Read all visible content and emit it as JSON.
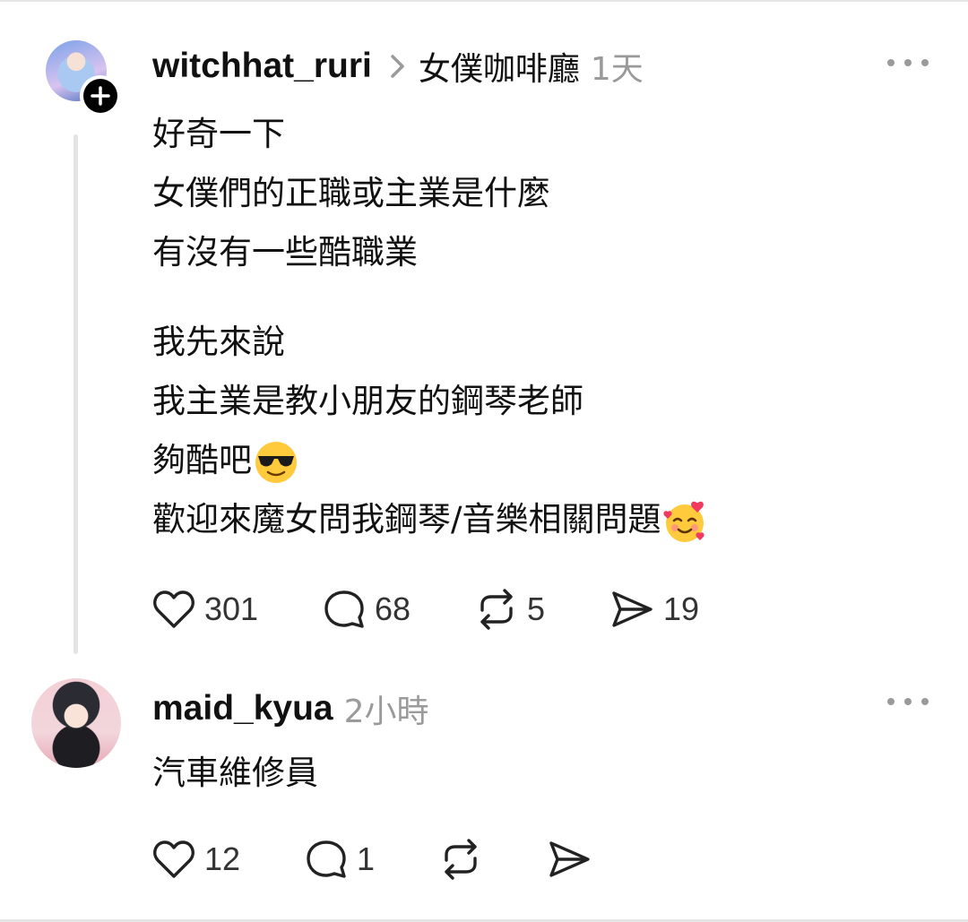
{
  "post1": {
    "username": "witchhat_ruri",
    "community": "女僕咖啡廳",
    "time": "1天",
    "lines": [
      "好奇一下",
      "女僕們的正職或主業是什麼",
      "有沒有一些酷職業",
      "",
      "我先來說",
      "我主業是教小朋友的鋼琴老師",
      "夠酷吧",
      "歡迎來魔女問我鋼琴/音樂相關問題"
    ],
    "likes": "301",
    "comments": "68",
    "reposts": "5",
    "shares": "19"
  },
  "post2": {
    "username": "maid_kyua",
    "time": "2小時",
    "text": "汽車維修員",
    "likes": "12",
    "comments": "1"
  },
  "icons": {
    "like": "heart-icon",
    "comment": "comment-bubble-icon",
    "repost": "repost-icon",
    "share": "send-icon",
    "more": "more-dots-icon",
    "follow": "plus-icon",
    "emoji1": "sunglasses-emoji",
    "emoji2": "smiling-hearts-emoji"
  }
}
